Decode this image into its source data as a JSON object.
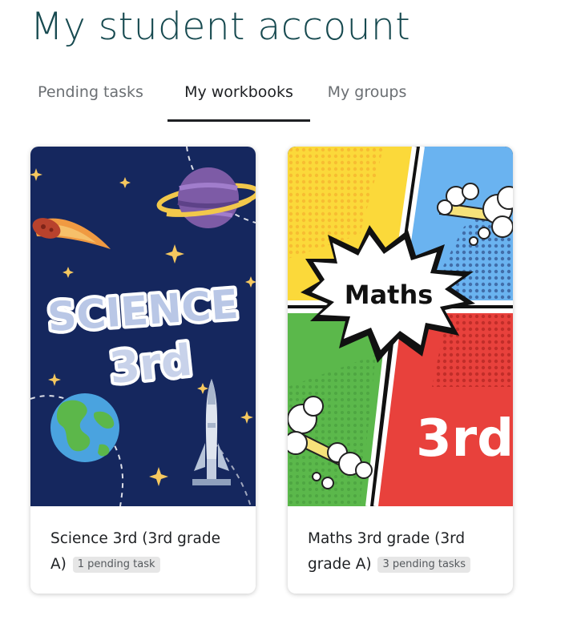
{
  "page": {
    "title": "My student account"
  },
  "tabs": [
    {
      "label": "Pending tasks",
      "active": false
    },
    {
      "label": "My workbooks",
      "active": true
    },
    {
      "label": "My groups",
      "active": false
    }
  ],
  "workbooks": [
    {
      "title": "Science 3rd (3rd grade A)",
      "title_line1": "Science 3rd (3rd grade",
      "title_line2": "A)",
      "badge": "1 pending task",
      "cover": {
        "line1": "SCIENCE",
        "line2": "3rd",
        "background": "#15275e",
        "icons": [
          "planet-icon",
          "comet-icon",
          "earth-icon",
          "rocket-icon",
          "star-icon"
        ]
      }
    },
    {
      "title": "Maths 3rd grade (3rd grade A)",
      "title_line1": "Maths 3rd grade (3rd",
      "title_line2": "grade A)",
      "badge": "3 pending tasks",
      "cover": {
        "label": "Maths",
        "grade": "3rd",
        "colors": {
          "yellow": "#fbd93a",
          "blue": "#6ab3f0",
          "green": "#5bb84b",
          "red": "#e8413c"
        },
        "icons": [
          "burst-icon",
          "smoke-icon"
        ]
      }
    }
  ]
}
